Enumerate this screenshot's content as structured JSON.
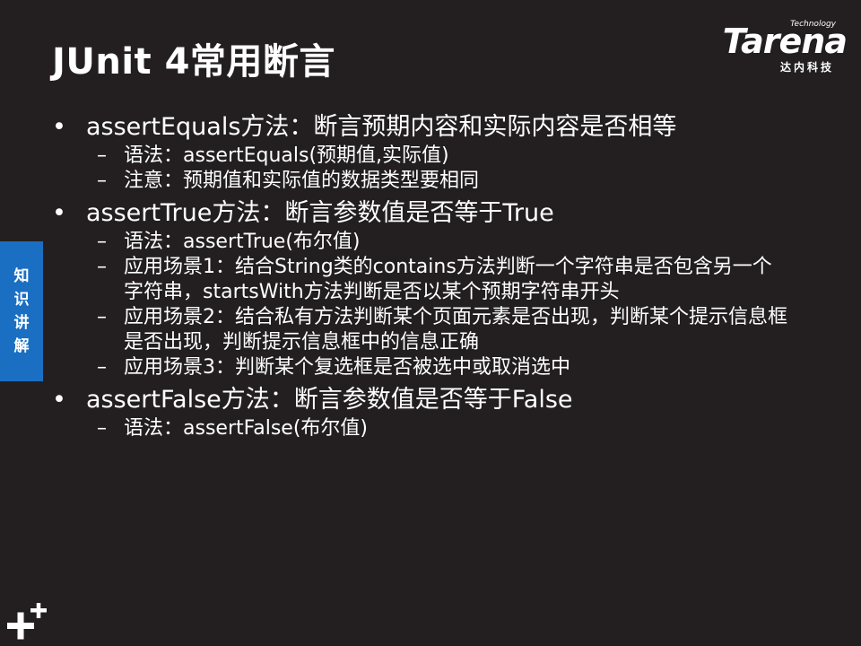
{
  "slide": {
    "title": "JUnit 4常用断言",
    "side_tab": [
      "知",
      "识",
      "讲",
      "解"
    ]
  },
  "logo": {
    "tech": "Technology",
    "word": "Tarena",
    "sub": "达内科技"
  },
  "bullets": [
    {
      "text": "assertEquals方法：断言预期内容和实际内容是否相等",
      "items": [
        "语法：assertEquals(预期值,实际值)",
        "注意：预期值和实际值的数据类型要相同"
      ]
    },
    {
      "text": "assertTrue方法：断言参数值是否等于True",
      "items": [
        "语法：assertTrue(布尔值)",
        "应用场景1：结合String类的contains方法判断一个字符串是否包含另一个字符串，startsWith方法判断是否以某个预期字符串开头",
        "应用场景2：结合私有方法判断某个页面元素是否出现，判断某个提示信息框是否出现，判断提示信息框中的信息正确",
        "应用场景3：判断某个复选框是否被选中或取消选中"
      ]
    },
    {
      "text": "assertFalse方法：断言参数值是否等于False",
      "items": [
        "语法：assertFalse(布尔值)"
      ]
    }
  ]
}
